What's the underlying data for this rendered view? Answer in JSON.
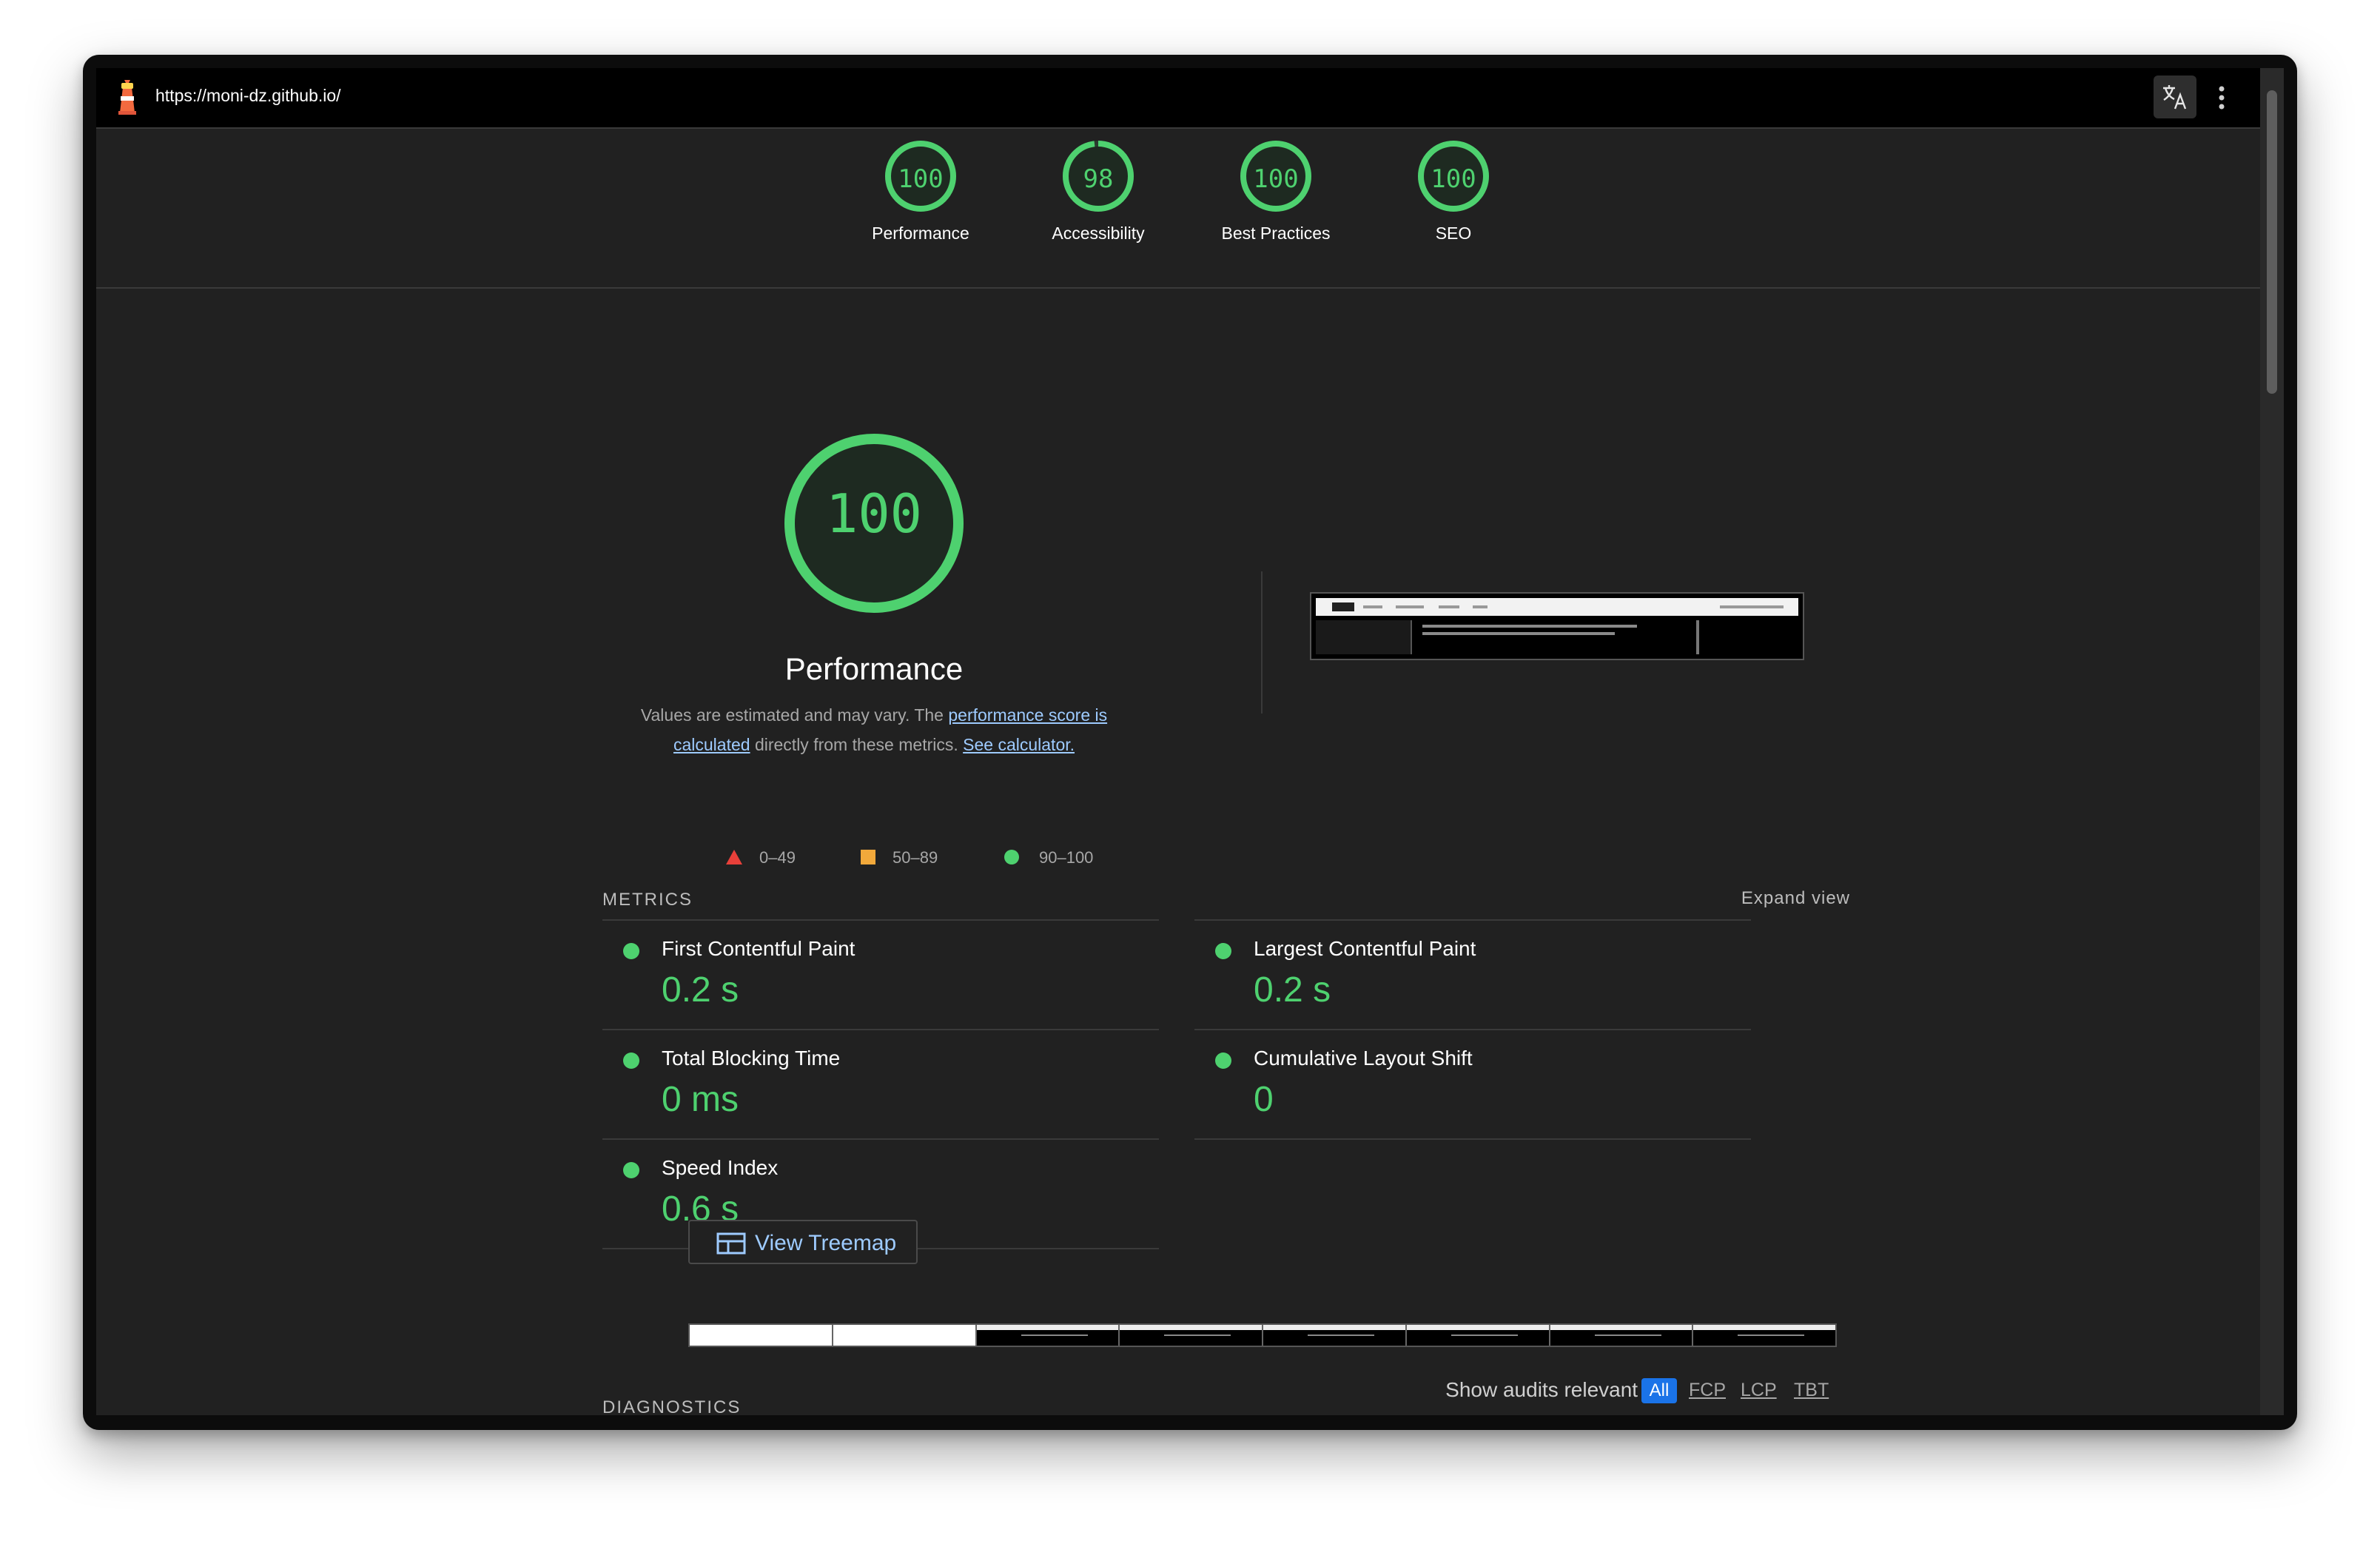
{
  "url": "https://moni-dz.github.io/",
  "categories": [
    {
      "score": "100",
      "label": "Performance"
    },
    {
      "score": "98",
      "label": "Accessibility"
    },
    {
      "score": "100",
      "label": "Best Practices"
    },
    {
      "score": "100",
      "label": "SEO"
    }
  ],
  "category_fill": [
    1.0,
    0.98,
    1.0,
    1.0
  ],
  "performance": {
    "score": "100",
    "title": "Performance",
    "desc_prefix": "Values are estimated and may vary. The ",
    "desc_link1": "performance score is calculated",
    "desc_mid": " directly from these metrics. ",
    "desc_link2": "See calculator."
  },
  "legend": {
    "fail": "0–49",
    "average": "50–89",
    "pass": "90–100"
  },
  "metrics_section": {
    "title": "METRICS",
    "expand": "Expand view"
  },
  "metrics": [
    {
      "name": "First Contentful Paint",
      "value": "0.2 s"
    },
    {
      "name": "Largest Contentful Paint",
      "value": "0.2 s"
    },
    {
      "name": "Total Blocking Time",
      "value": "0 ms"
    },
    {
      "name": "Cumulative Layout Shift",
      "value": "0"
    },
    {
      "name": "Speed Index",
      "value": "0.6 s"
    }
  ],
  "treemap_button": "View Treemap",
  "filter": {
    "label": "Show audits relevant to:",
    "all": "All",
    "fcp": "FCP",
    "lcp": "LCP",
    "tbt": "TBT"
  },
  "diagnostics_title": "DIAGNOSTICS",
  "colors": {
    "pass": "#4ed16f",
    "average": "#f2a93b",
    "fail": "#e8403a",
    "link": "#9ecbff",
    "accent": "#1a73e8"
  }
}
